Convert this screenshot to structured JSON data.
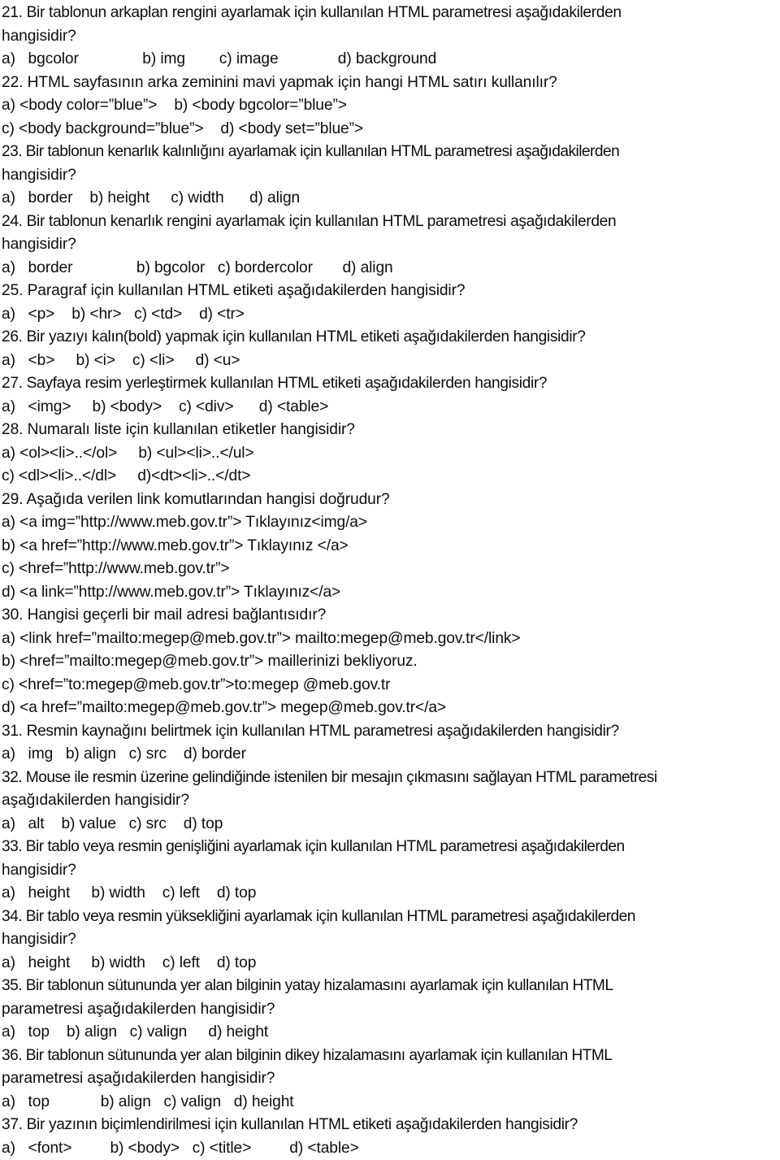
{
  "document": {
    "type": "multiple-choice-quiz",
    "language": "tr",
    "subject": "HTML",
    "question_range": "21-37",
    "text_color": "#0d0d0d",
    "background_color": "#ffffff",
    "lines": [
      "21. Bir tablonun arkaplan rengini ayarlamak için kullanılan HTML parametresi aşağıdakilerden",
      "hangisidir?",
      "a)   bgcolor               b) img        c) image              d) background",
      "22. HTML sayfasının arka zeminini mavi yapmak için hangi HTML satırı kullanılır?",
      "a) <body color=”blue”>    b) <body bgcolor=”blue”>",
      "c) <body background=”blue”>    d) <body set=”blue”>",
      "23. Bir tablonun kenarlık kalınlığını ayarlamak için kullanılan HTML parametresi aşağıdakilerden",
      "hangisidir?",
      "a)   border    b) height     c) width      d) align",
      "24. Bir tablonun kenarlık rengini ayarlamak için kullanılan HTML parametresi aşağıdakilerden",
      "hangisidir?",
      "a)   border               b) bgcolor   c) bordercolor       d) align",
      "25. Paragraf için kullanılan HTML etiketi aşağıdakilerden hangisidir?",
      "a)   <p>    b) <hr>   c) <td>    d) <tr>",
      "26. Bir yazıyı kalın(bold) yapmak için kullanılan HTML etiketi aşağıdakilerden hangisidir?",
      "a)   <b>     b) <i>    c) <li>     d) <u>",
      "27. Sayfaya resim yerleştirmek kullanılan HTML etiketi aşağıdakilerden hangisidir?",
      "a)   <img>     b) <body>    c) <div>      d) <table>",
      "28. Numaralı liste için kullanılan etiketler hangisidir?",
      "a) <ol><li>..</ol>     b) <ul><li>..</ul>",
      "c) <dl><li>..</dl>     d)<dt><li>..</dt>",
      "29. Aşağıda verilen link komutlarından hangisi doğrudur?",
      "a) <a img=”http://www.meb.gov.tr”> Tıklayınız<img/a>",
      "b) <a href=”http://www.meb.gov.tr”> Tıklayınız </a>",
      "c) <href=”http://www.meb.gov.tr”>",
      "d) <a link=”http://www.meb.gov.tr”> Tıklayınız</a>",
      "30. Hangisi geçerli bir mail adresi bağlantısıdır?",
      "a) <link href=”mailto:megep@meb.gov.tr”> mailto:megep@meb.gov.tr</link>",
      "b) <href=”mailto:megep@meb.gov.tr”> maillerinizi bekliyoruz.",
      "c) <href=”to:megep@meb.gov.tr”>to:megep @meb.gov.tr",
      "d) <a href=”mailto:megep@meb.gov.tr”> megep@meb.gov.tr</a>",
      "31. Resmin kaynağını belirtmek için kullanılan HTML parametresi aşağıdakilerden hangisidir?",
      "a)   img   b) align   c) src    d) border",
      "32. Mouse ile resmin üzerine gelindiğinde istenilen bir mesajın çıkmasını sağlayan HTML parametresi",
      "aşağıdakilerden hangisidir?",
      "a)   alt    b) value   c) src    d) top",
      "33. Bir tablo veya resmin genişliğini ayarlamak için kullanılan HTML parametresi aşağıdakilerden",
      "hangisidir?",
      "a)   height     b) width    c) left    d) top",
      "34. Bir tablo veya resmin yüksekliğini ayarlamak için kullanılan HTML parametresi aşağıdakilerden",
      "hangisidir?",
      "a)   height     b) width    c) left    d) top",
      "35. Bir tablonun sütununda yer alan bilginin yatay hizalamasını ayarlamak için kullanılan HTML",
      "parametresi aşağıdakilerden hangisidir?",
      "a)   top    b) align   c) valign     d) height",
      "36. Bir tablonun sütununda yer alan bilginin dikey hizalamasını ayarlamak için kullanılan HTML",
      "parametresi aşağıdakilerden hangisidir?",
      "a)   top            b) align   c) valign   d) height",
      "37. Bir yazının biçimlendirilmesi için kullanılan HTML etiketi aşağıdakilerden hangisidir?",
      "a)   <font>         b) <body>   c) <title>         d) <table>"
    ]
  }
}
